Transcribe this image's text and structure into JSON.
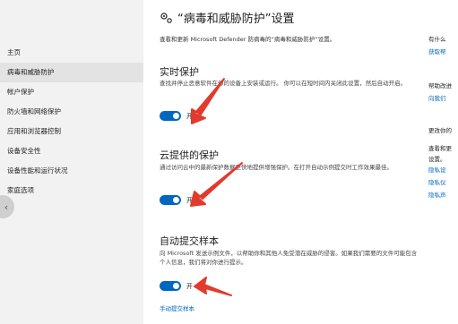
{
  "sidebar": {
    "items": [
      {
        "label": "主页"
      },
      {
        "label": "病毒和威胁防护",
        "active": true
      },
      {
        "label": "帐户保护"
      },
      {
        "label": "防火墙和网络保护"
      },
      {
        "label": "应用和浏览器控制"
      },
      {
        "label": "设备安全性"
      },
      {
        "label": "设备性能和运行状况"
      },
      {
        "label": "家庭选项"
      }
    ]
  },
  "page": {
    "title": "“病毒和威胁防护”设置",
    "subtitle": "查看和更新 Microsoft Defender 防病毒的“病毒和威胁防护”设置。"
  },
  "sections": [
    {
      "heading": "实时保护",
      "desc": "查找并停止恶意软件在你的设备上安装或运行。 你可以在短时间内关闭此设置，然后自动开启。",
      "toggle_label": "开"
    },
    {
      "heading": "云提供的保护",
      "desc": "通过访问云中的最新保护数据更快地提供增强保护。在打开自动示例提交时工作效果最佳。",
      "toggle_label": "开"
    },
    {
      "heading": "自动提交样本",
      "desc": "向 Microsoft 发送示例文件，以帮助你和其他人免受潜在威胁的侵害。如果我们需要的文件可能包含个人信息，我们将对你进行提示。",
      "toggle_label": "开",
      "link": "手动提交样本"
    }
  ],
  "right_panel": {
    "q1": "有什么",
    "link1": "获取帮",
    "q2": "帮助改进",
    "link2": "向我们",
    "q3": "更改你的",
    "q3b": "查看和更",
    "q3c": "设置。",
    "link3a": "隐私设",
    "link3b": "隐私仪",
    "link3c": "隐私声"
  },
  "colors": {
    "accent": "#0067c0",
    "sidebar_bg": "#f2f2f2",
    "arrow": "#e23a2c"
  },
  "icons": {
    "title": "gear-icon",
    "back": "chevron-left-icon"
  }
}
